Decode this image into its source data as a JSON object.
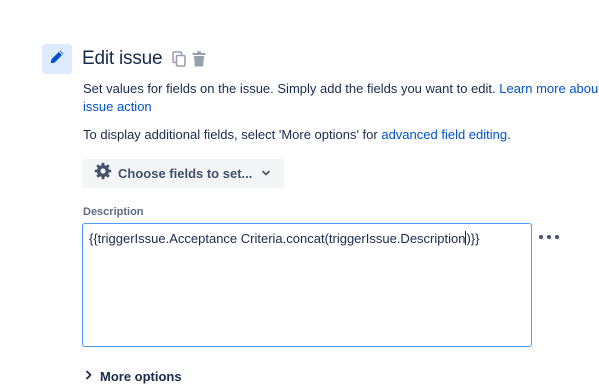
{
  "header": {
    "title": "Edit issue",
    "icons": [
      "pencil-icon",
      "copy-icon",
      "trash-icon"
    ]
  },
  "intro": {
    "text": "Set values for fields on the issue. Simply add the fields you want to edit. ",
    "link_line1": "Learn more abou",
    "link_line2": "issue action"
  },
  "advanced": {
    "text_before": "To display additional fields, select 'More options' for ",
    "link": "advanced field editing",
    "text_after": "."
  },
  "choose_fields": {
    "label": "Choose fields to set...",
    "icons": [
      "gear-icon",
      "chevron-down-icon"
    ]
  },
  "description_field": {
    "label": "Description",
    "value_before_caret": "{{triggerIssue.Acceptance Criteria.concat(triggerIssue.Description",
    "value_after_caret": ")}}"
  },
  "more_options": {
    "label": "More options",
    "icon": "chevron-right-icon"
  },
  "colors": {
    "accent": "#0052cc",
    "focus_border": "#4c9aff",
    "icon_bg": "#deebff",
    "button_bg": "#f4f5f7",
    "text": "#172b4d",
    "subtle_text": "#5e6c84"
  }
}
